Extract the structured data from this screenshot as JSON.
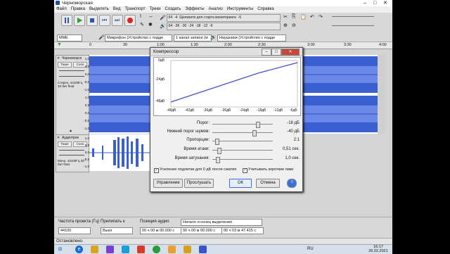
{
  "window_title": "Черноморская",
  "menu": [
    "Файл",
    "Правка",
    "Выделить",
    "Вид",
    "Транспорт",
    "Треки",
    "Создать",
    "Эффекты",
    "Анализ",
    "Инструменты",
    "Справка"
  ],
  "meter": {
    "labels": [
      "-54",
      "-48",
      "-42",
      "-36",
      "-30",
      "-24",
      "-18",
      "-12",
      "-6",
      "0"
    ],
    "hint": "Щелкните для старта мониторинга",
    "scale": [
      "-54",
      "-4",
      "-36",
      "-30",
      "-24",
      "-18",
      "-12",
      "-6"
    ]
  },
  "devices": {
    "host": "MME",
    "mic": "Микрофон (Устройство с подде",
    "channels": "1 канал записи (м",
    "output": "Наушники (Устройство с подде"
  },
  "ruler": [
    "0",
    "30",
    "1:00",
    "1:30",
    "2:00",
    "2:30",
    "3:00",
    "3:30",
    "4:00"
  ],
  "track1": {
    "name": "Черноморск",
    "mute": "Тише",
    "solo": "Соло",
    "info": "Стерео, 44100Гц 32-бит float",
    "scale": [
      "1,0",
      "0,5",
      "0,0",
      "-0,5",
      "-1,0",
      "1,0",
      "0,5",
      "0,0",
      "-0,5",
      "-1,0"
    ]
  },
  "track2": {
    "name": "Аудиотрек",
    "mute": "Тише",
    "solo": "Соло",
    "info": "Моно, 44100Гц 32-бит float",
    "scale": [
      "1,0",
      "0,5",
      "0,0",
      "-0,5",
      "-1,0"
    ]
  },
  "dialog": {
    "title": "Компрессор",
    "graph_y": [
      "0дБ",
      "-24дБ",
      "-48дБ"
    ],
    "graph_x": [
      "-48дБ",
      "-42дБ",
      "-36дБ",
      "-30дБ",
      "-24дБ",
      "-18дБ",
      "-12дБ",
      "-6дБ"
    ],
    "params": [
      {
        "label": "Порог:",
        "value": "-18 дБ",
        "level": 0.75
      },
      {
        "label": "Нижний порог шумов:",
        "value": "-40 дБ",
        "level": 0.7
      },
      {
        "label": "Пропорции:",
        "value": "2:1",
        "level": 0.05
      },
      {
        "label": "Время атаки:",
        "value": "0,51 сек.",
        "level": 0.08
      },
      {
        "label": "Время затухания:",
        "value": "1,0 сек.",
        "level": 0.06
      }
    ],
    "check1": "Усиление подлитки для 0 дБ после сжатия",
    "check2": "Учитывать короткие пики",
    "buttons": {
      "manage": "Управление",
      "preview": "Прослушать",
      "ok": "ОК",
      "cancel": "Отмена",
      "help": "?"
    }
  },
  "bottom": {
    "rate_label": "Частота проекта (Гц)",
    "snap_label": "Прилипать к",
    "pos_label": "Позиция аудио",
    "sel_label": "Начало и конец выделения",
    "rate": "44100",
    "snap": "Выкл",
    "pos": "00 ч 00 м 00.000 с",
    "sel_start": "00 ч 00 м 00.000 с",
    "sel_end": "00 ч 03 м 47.415 с"
  },
  "status": "Остановлено.",
  "taskbar": {
    "lang": "RU",
    "time": "16:17",
    "date": "26.02.2021"
  }
}
